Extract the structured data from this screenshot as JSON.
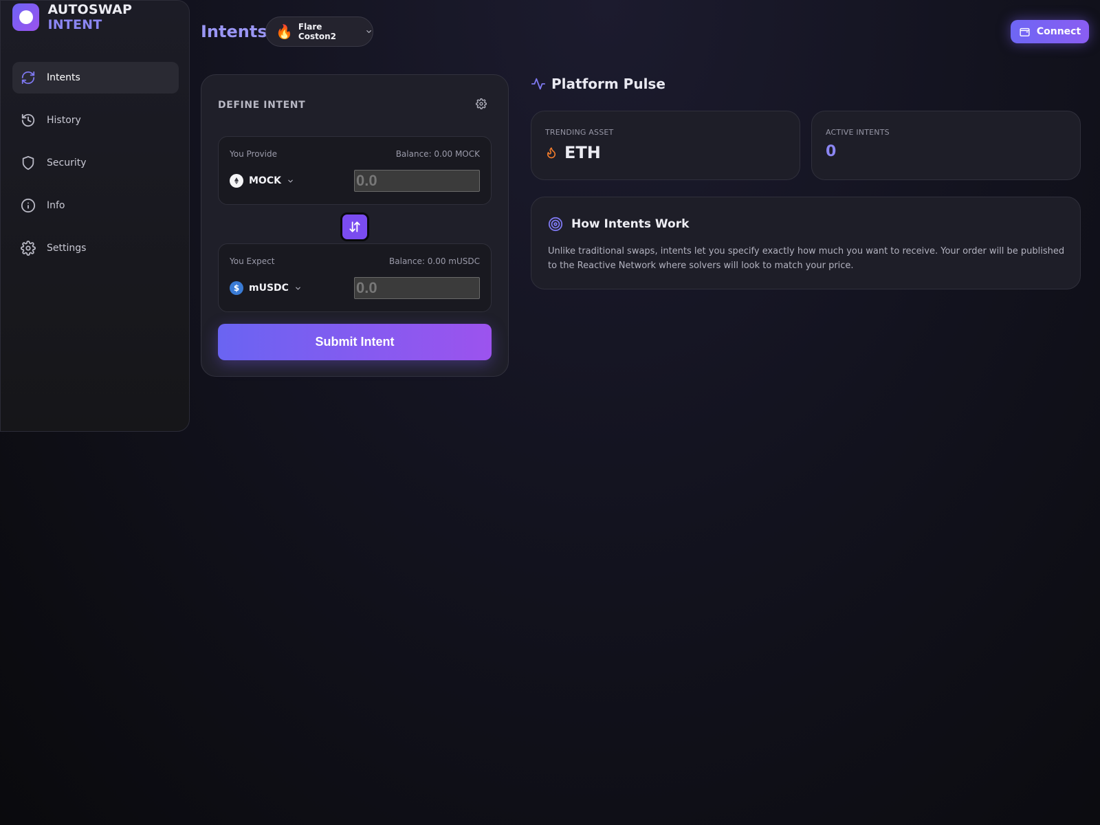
{
  "brand": {
    "part1": "AUTOSWAP",
    "part2": "INTENT"
  },
  "sidebar": {
    "items": [
      {
        "label": "Intents",
        "icon": "refresh-icon",
        "active": true
      },
      {
        "label": "History",
        "icon": "history-icon",
        "active": false
      },
      {
        "label": "Security",
        "icon": "shield-icon",
        "active": false
      },
      {
        "label": "Info",
        "icon": "info-icon",
        "active": false
      },
      {
        "label": "Settings",
        "icon": "gear-icon",
        "active": false
      }
    ]
  },
  "header": {
    "title": "Intents",
    "network": {
      "name": "Flare Coston2",
      "icon": "flame-icon"
    },
    "connect_label": "Connect"
  },
  "intent_card": {
    "title": "DEFINE INTENT",
    "provide": {
      "label": "You Provide",
      "balance": "Balance: 0.00 MOCK",
      "token": "MOCK",
      "placeholder": "0.0"
    },
    "expect": {
      "label": "You Expect",
      "balance": "Balance: 0.00 mUSDC",
      "token": "mUSDC",
      "placeholder": "0.0"
    },
    "submit_label": "Submit Intent"
  },
  "pulse": {
    "title": "Platform Pulse",
    "trending": {
      "label": "TRENDING ASSET",
      "value": "ETH"
    },
    "active": {
      "label": "ACTIVE INTENTS",
      "value": "0"
    }
  },
  "how": {
    "title": "How Intents Work",
    "body": "Unlike traditional swaps, intents let you specify exactly how much you want to receive. Your order will be published to the Reactive Network where solvers will look to match your price."
  },
  "colors": {
    "accent": "#7e78f0",
    "accent_gradient_start": "#6a64f2",
    "accent_gradient_end": "#9c53ee",
    "flame": "#f07b2c",
    "background": "#13131f"
  }
}
